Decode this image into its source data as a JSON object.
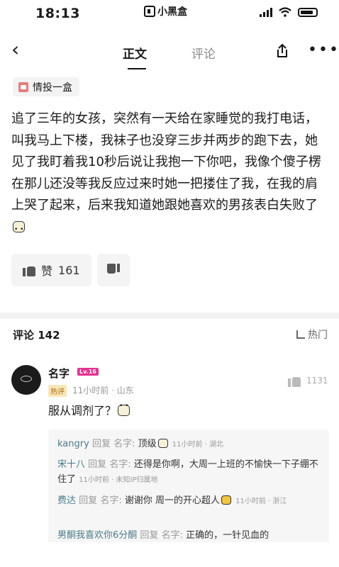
{
  "status_bar": {
    "time": "18:13",
    "app_name": "小黑盒"
  },
  "nav": {
    "tab_main": "正文",
    "tab_comments": "评论"
  },
  "tag": {
    "label": "情投一盒"
  },
  "post": {
    "body": "追了三年的女孩，突然有一天给在家睡觉的我打电话，叫我马上下楼，我袜子也没穿三步并两步的跑下去，她见了我盯着我10秒后说让我抱一下你吧，我像个傻子楞在那儿还没等我反应过来时她一把搂住了我，在我的肩上哭了起来，后来我知道她跟她喜欢的男孩表白失败了"
  },
  "actions": {
    "like_label": "赞",
    "like_count": "161"
  },
  "comments": {
    "title": "评论",
    "count": "142",
    "sort_label": "热门"
  },
  "top_comment": {
    "name": "名字",
    "level": "Lv.16",
    "badge": "热评",
    "meta": "11小时前 · 山东",
    "likes": "1131",
    "text": "服从调剂了？"
  },
  "replies": [
    {
      "user": "kangry",
      "reply_word": "回复",
      "to": "名字:",
      "text": "顶级",
      "meta": "11小时前 · 湖北"
    },
    {
      "user": "宋十八",
      "reply_word": "回复",
      "to": "名字:",
      "text": "还得是你啊，大周一上班的不愉快一下子绷不住了",
      "meta": "11小时前 · 未知IP归属地"
    },
    {
      "user": "费达",
      "reply_word": "回复",
      "to": "名字:",
      "text": "谢谢你 周一的开心超人",
      "meta": "11小时前 · 浙江"
    },
    {
      "user": "男酮我喜欢你6分酮",
      "reply_word": "回复",
      "to": "名字:",
      "text": "正确的，一针见血的"
    }
  ],
  "icons": {
    "back": "chevron-left-icon",
    "share": "share-icon",
    "more": "more-icon",
    "like": "thumb-up-icon",
    "dislike": "thumb-down-icon"
  },
  "colors": {
    "level_badge": "#e6308f",
    "hot_badge_bg": "#fbe6b8",
    "reply_user": "#4a7c8c"
  }
}
